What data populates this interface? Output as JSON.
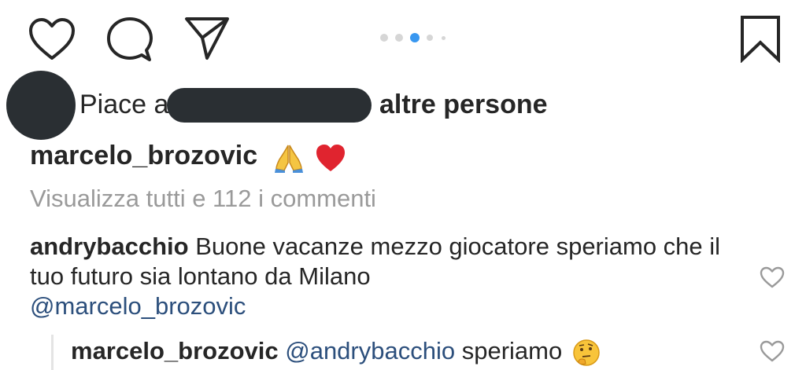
{
  "actions": {
    "like_icon": "heart-outline-icon",
    "comment_icon": "comment-bubble-icon",
    "share_icon": "paper-plane-icon",
    "save_icon": "bookmark-icon",
    "carousel_dots": 5,
    "carousel_active_index": 2
  },
  "likes": {
    "prefix": "Piace a",
    "suffix": "altre persone"
  },
  "caption": {
    "username": "marcelo_brozovic",
    "emoji": "🙏❤️"
  },
  "view_all_comments": "Visualizza tutti e 112 i commenti",
  "comments": [
    {
      "username": "andrybacchio",
      "text": "Buone vacanze mezzo giocatore speriamo che il tuo futuro sia lontano da Milano",
      "mention": "@marcelo_brozovic"
    }
  ],
  "reply": {
    "username": "marcelo_brozovic",
    "mention": "@andrybacchio",
    "text": "speriamo",
    "emoji": "🤔"
  },
  "colors": {
    "text": "#262626",
    "muted": "#9a9a9a",
    "mention": "#2c4f7c",
    "active_dot": "#3897f0",
    "inactive_dot": "#d6d6d6",
    "redaction": "#2a2f33"
  }
}
